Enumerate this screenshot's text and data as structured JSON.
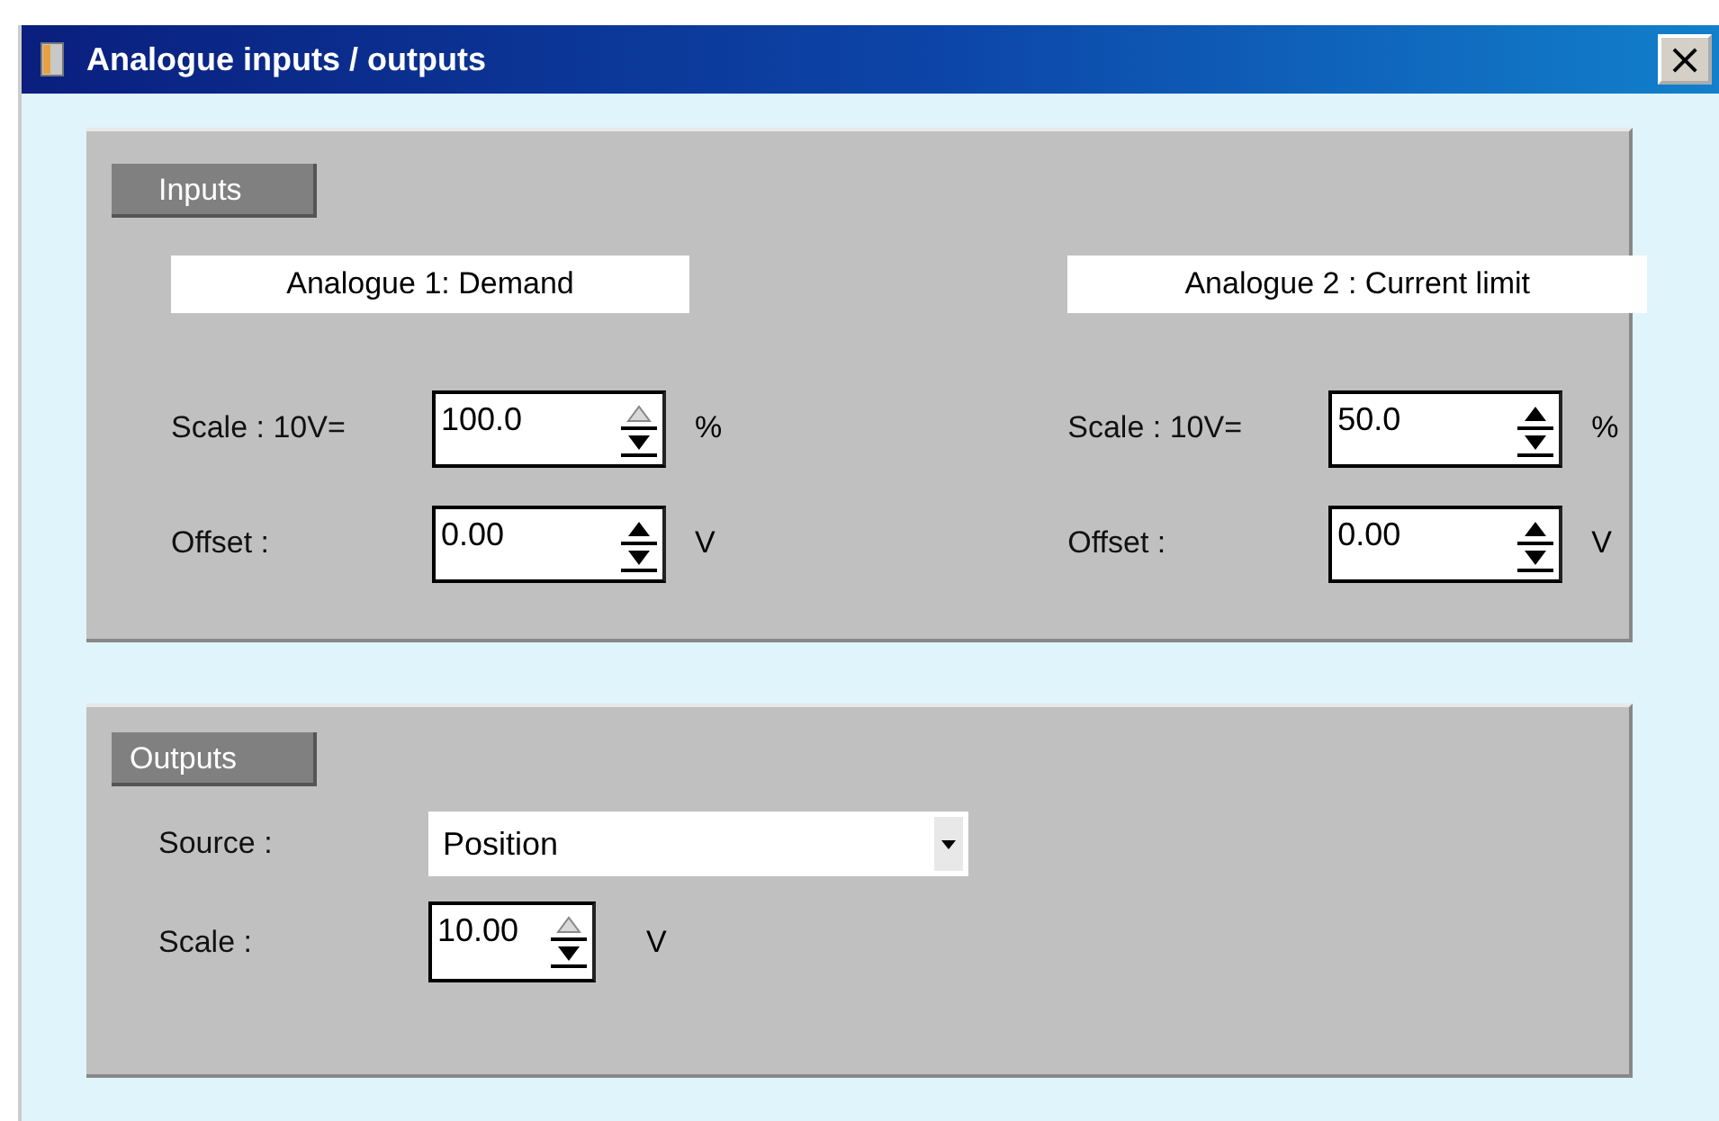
{
  "window": {
    "title": "Analogue inputs / outputs",
    "close": "×"
  },
  "inputs": {
    "heading": "Inputs",
    "channels": [
      {
        "title": "Analogue 1: Demand",
        "fields": [
          {
            "label": "Scale : 10V=",
            "value": "100.0",
            "unit": "%",
            "up_disabled": true
          },
          {
            "label": "Offset :",
            "value": "0.00",
            "unit": "V",
            "up_disabled": false
          }
        ]
      },
      {
        "title": "Analogue 2 : Current limit",
        "fields": [
          {
            "label": "Scale : 10V=",
            "value": "50.0",
            "unit": "%",
            "up_disabled": false
          },
          {
            "label": "Offset :",
            "value": "0.00",
            "unit": "V",
            "up_disabled": false
          }
        ]
      }
    ]
  },
  "outputs": {
    "heading": "Outputs",
    "source": {
      "label": "Source :",
      "value": "Position"
    },
    "scale": {
      "label": "Scale :",
      "value": "10.00",
      "unit": "V",
      "up_disabled": true
    }
  }
}
